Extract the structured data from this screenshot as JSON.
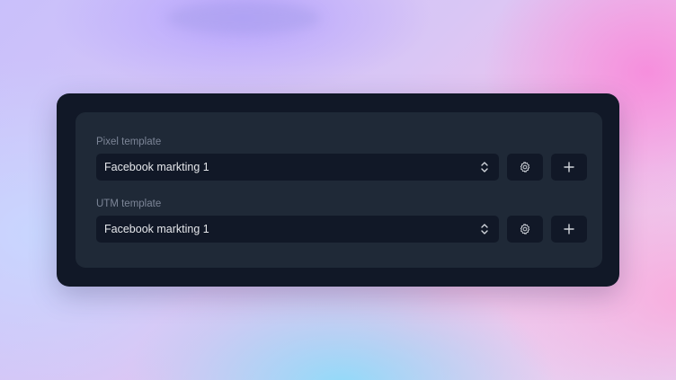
{
  "form": {
    "pixel": {
      "label": "Pixel template",
      "selected": "Facebook markting 1"
    },
    "utm": {
      "label": "UTM template",
      "selected": "Facebook markting 1"
    }
  },
  "icons": {
    "dropdown": "chevron-up-down-icon",
    "settings": "gear-icon",
    "add": "plus-icon"
  },
  "colors": {
    "card": "#111827",
    "panel": "#1f2937",
    "label": "#7c8597",
    "text": "#e5e7eb"
  }
}
